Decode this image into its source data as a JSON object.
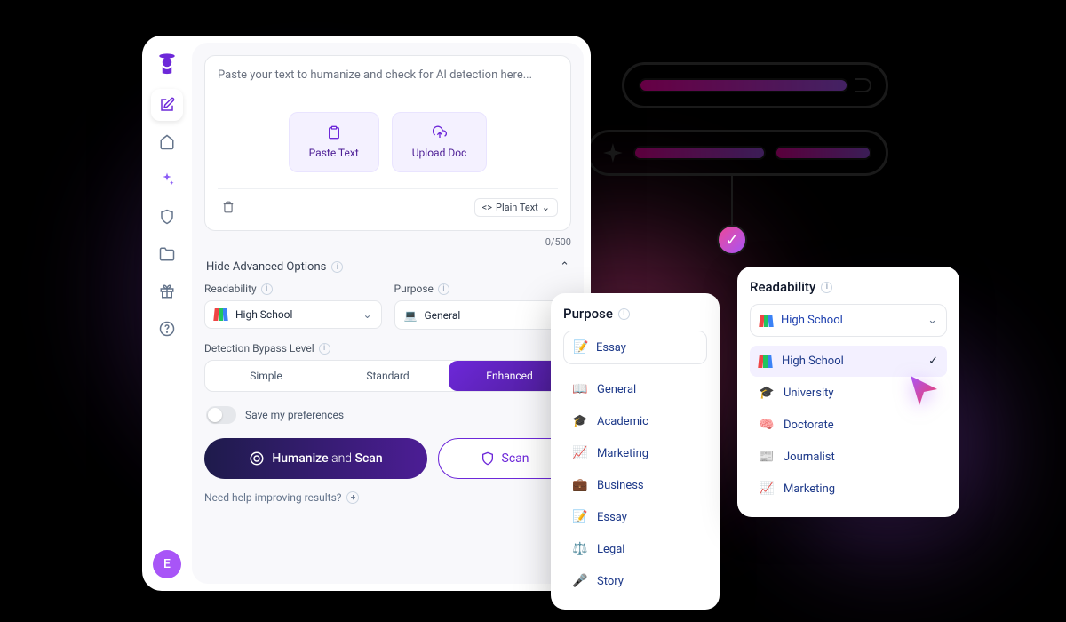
{
  "sidebar": {
    "avatar_letter": "E"
  },
  "editor": {
    "placeholder": "Paste your text to humanize and check for AI detection here...",
    "paste_label": "Paste Text",
    "upload_label": "Upload Doc",
    "format_label": "Plain Text",
    "counter": "0/500"
  },
  "advanced": {
    "toggle_label": "Hide Advanced Options",
    "readability": {
      "label": "Readability",
      "value": "High School"
    },
    "purpose": {
      "label": "Purpose",
      "value": "General"
    },
    "bypass": {
      "label": "Detection Bypass Level",
      "options": [
        "Simple",
        "Standard",
        "Enhanced"
      ],
      "selected": "Enhanced"
    },
    "save_pref": "Save my preferences"
  },
  "cta": {
    "primary_pre": "Humanize ",
    "primary_mid": "and",
    "primary_post": " Scan",
    "secondary": "Scan"
  },
  "help": "Need help improving results?",
  "purpose_popup": {
    "title": "Purpose",
    "selected": "Essay",
    "items": [
      "General",
      "Academic",
      "Marketing",
      "Business",
      "Essay",
      "Legal",
      "Story"
    ]
  },
  "readability_popup": {
    "title": "Readability",
    "selected": "High School",
    "items": [
      "High School",
      "University",
      "Doctorate",
      "Journalist",
      "Marketing"
    ]
  },
  "icons": {
    "general": "📖",
    "academic": "🎓",
    "marketing": "📈",
    "business": "💼",
    "essay": "📝",
    "legal": "⚖️",
    "story": "🎤",
    "university": "🎓",
    "doctorate": "🧠",
    "journalist": "📰"
  }
}
